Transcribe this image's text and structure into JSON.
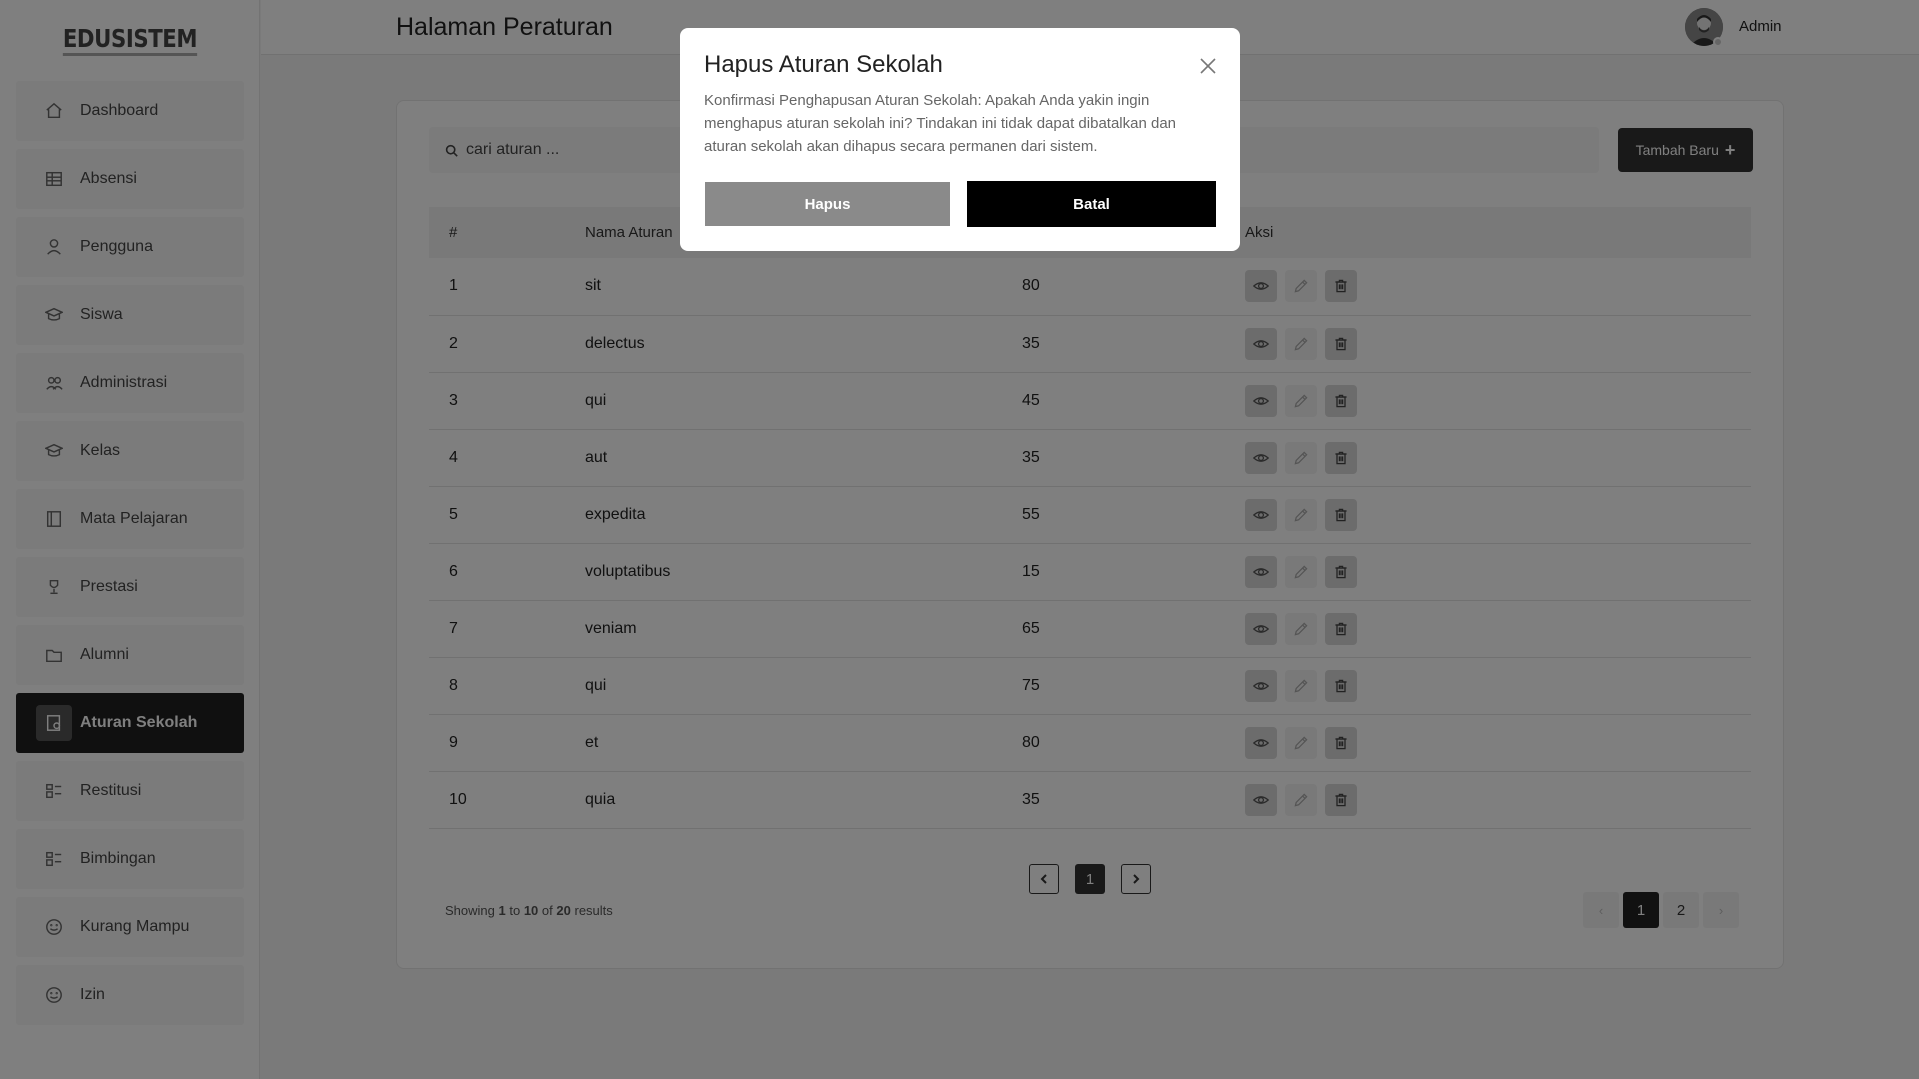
{
  "app": {
    "logo": "EDUSISTEM"
  },
  "header": {
    "title": "Halaman Peraturan",
    "user_name": "Admin"
  },
  "sidebar": {
    "items": [
      {
        "label": "Dashboard",
        "icon": "home-icon",
        "active": false
      },
      {
        "label": "Absensi",
        "icon": "table-icon",
        "active": false
      },
      {
        "label": "Pengguna",
        "icon": "user-icon",
        "active": false
      },
      {
        "label": "Siswa",
        "icon": "graduation-cap-icon",
        "active": false
      },
      {
        "label": "Administrasi",
        "icon": "users-icon",
        "active": false
      },
      {
        "label": "Kelas",
        "icon": "graduation-cap-icon",
        "active": false
      },
      {
        "label": "Mata Pelajaran",
        "icon": "book-icon",
        "active": false
      },
      {
        "label": "Prestasi",
        "icon": "trophy-icon",
        "active": false
      },
      {
        "label": "Alumni",
        "icon": "folder-icon",
        "active": false
      },
      {
        "label": "Aturan Sekolah",
        "icon": "rule-book-icon",
        "active": true
      },
      {
        "label": "Restitusi",
        "icon": "chart-icon",
        "active": false
      },
      {
        "label": "Bimbingan",
        "icon": "chart-icon",
        "active": false
      },
      {
        "label": "Kurang Mampu",
        "icon": "smile-icon",
        "active": false
      },
      {
        "label": "Izin",
        "icon": "smile-icon",
        "active": false
      }
    ]
  },
  "search": {
    "placeholder": "cari aturan ..."
  },
  "toolbar": {
    "add_label": "Tambah Baru"
  },
  "table": {
    "columns": [
      "#",
      "Nama Aturan",
      "",
      "Aksi"
    ],
    "rows": [
      {
        "no": "1",
        "name": "sit",
        "points": "80"
      },
      {
        "no": "2",
        "name": "delectus",
        "points": "35"
      },
      {
        "no": "3",
        "name": "qui",
        "points": "45"
      },
      {
        "no": "4",
        "name": "aut",
        "points": "35"
      },
      {
        "no": "5",
        "name": "expedita",
        "points": "55"
      },
      {
        "no": "6",
        "name": "voluptatibus",
        "points": "15"
      },
      {
        "no": "7",
        "name": "veniam",
        "points": "65"
      },
      {
        "no": "8",
        "name": "qui",
        "points": "75"
      },
      {
        "no": "9",
        "name": "et",
        "points": "80"
      },
      {
        "no": "10",
        "name": "quia",
        "points": "35"
      }
    ]
  },
  "pagination": {
    "current": "1",
    "results_prefix": "Showing",
    "from": "1",
    "to_word": "to",
    "to": "10",
    "of_word": "of",
    "total": "20",
    "results_word": "results",
    "pages": [
      "1",
      "2"
    ],
    "prev": "‹",
    "next": "›"
  },
  "modal": {
    "title": "Hapus Aturan Sekolah",
    "body": "Konfirmasi Penghapusan Aturan Sekolah: Apakah Anda yakin ingin menghapus aturan sekolah ini? Tindakan ini tidak dapat dibatalkan dan aturan sekolah akan dihapus secara permanen dari sistem.",
    "confirm_label": "Hapus",
    "cancel_label": "Batal"
  }
}
